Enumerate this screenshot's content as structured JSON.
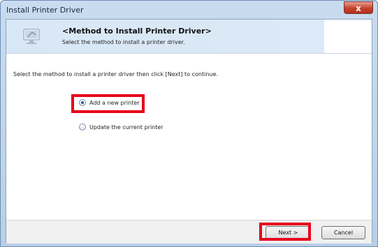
{
  "window": {
    "title": "Install Printer Driver",
    "close_glyph": "x"
  },
  "header": {
    "icon": "monitor-wizard-icon",
    "title": "<Method to Install Printer Driver>",
    "subtitle": "Select the method to install a printer driver."
  },
  "instruction": "Select the method to install a printer driver then click [Next] to continue.",
  "options": [
    {
      "label": "Add a new printer",
      "selected": true
    },
    {
      "label": "Update the current printer",
      "selected": false
    }
  ],
  "buttons": {
    "next": "Next >",
    "cancel": "Cancel"
  },
  "colors": {
    "highlight": "#e8001c",
    "header_band": "#d8e7f6",
    "footer": "#f0f0f0"
  }
}
